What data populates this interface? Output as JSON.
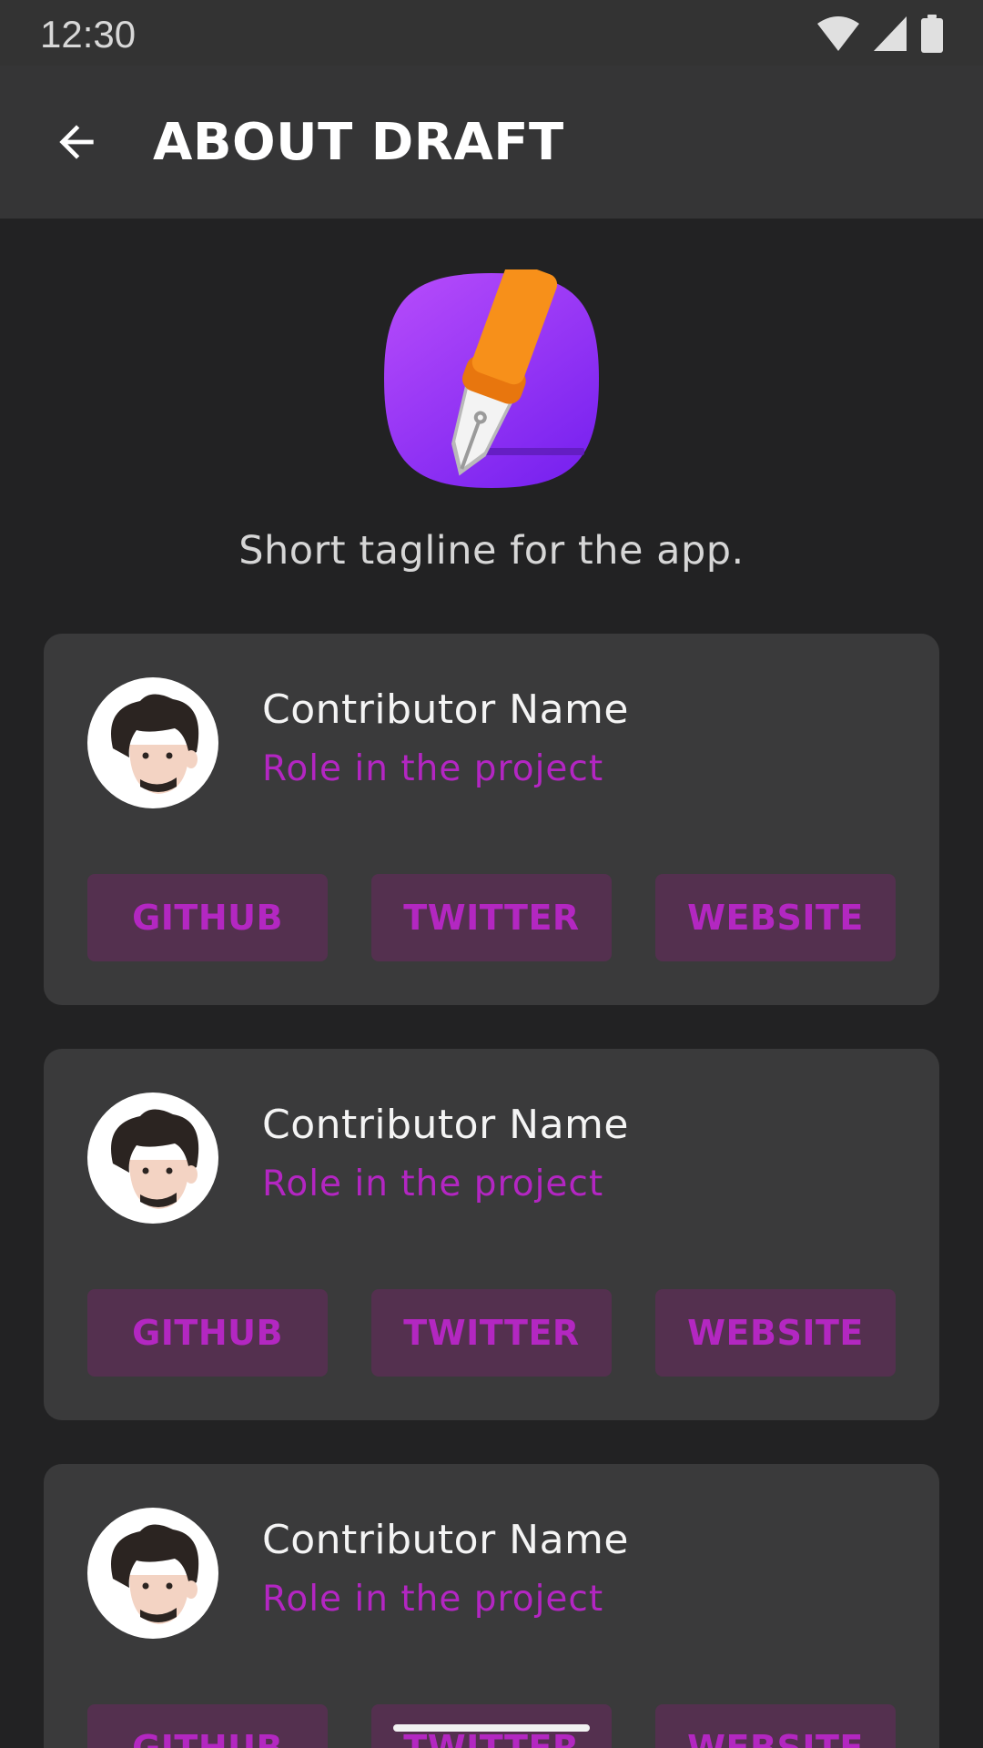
{
  "status_bar": {
    "time": "12:30",
    "icons": [
      "wifi-icon",
      "cell-signal-icon",
      "battery-icon"
    ]
  },
  "app_bar": {
    "back_icon": "arrow-back-icon",
    "title": "ABOUT DRAFT"
  },
  "header": {
    "logo_icon": "fountain-pen-logo",
    "tagline": "Short tagline for the app."
  },
  "contributors": [
    {
      "name": "Contributor Name",
      "role": "Role in the project",
      "buttons": {
        "github": "GITHUB",
        "twitter": "TWITTER",
        "website": "WEBSITE"
      }
    },
    {
      "name": "Contributor Name",
      "role": "Role in the project",
      "buttons": {
        "github": "GITHUB",
        "twitter": "TWITTER",
        "website": "WEBSITE"
      }
    },
    {
      "name": "Contributor Name",
      "role": "Role in the project",
      "buttons": {
        "github": "GITHUB",
        "twitter": "TWITTER",
        "website": "WEBSITE"
      }
    }
  ],
  "colors": {
    "background": "#222223",
    "app_bar": "#353536",
    "card": "#3a3a3b",
    "accent": "#b326c2",
    "button_bg": "#54304f",
    "logo_gradient_start": "#b84dfb",
    "logo_gradient_end": "#7b24f0",
    "pen_orange": "#f7901a"
  }
}
